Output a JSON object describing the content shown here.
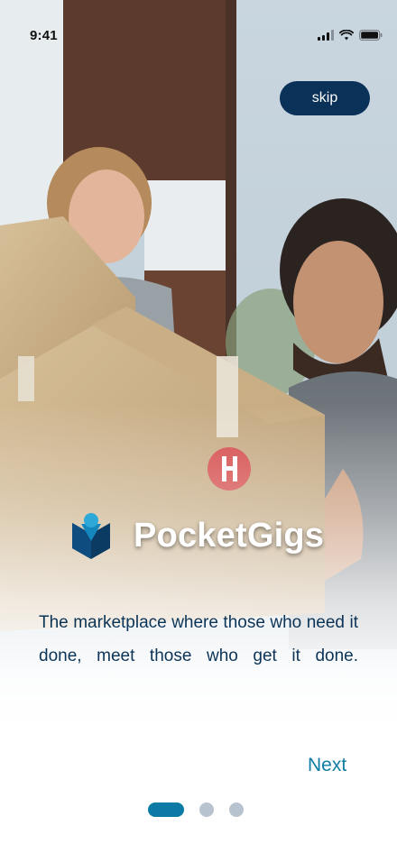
{
  "status_bar": {
    "time": "9:41",
    "icons": [
      "signal-icon",
      "wifi-icon",
      "battery-icon"
    ]
  },
  "hero": {
    "image": "photo-two-people-carrying-moving-boxes"
  },
  "skip_label": "skip",
  "brand": {
    "name": "PocketGigs",
    "logo_icon": "pocketgigs-logo-icon"
  },
  "tagline": "The marketplace where those who need it done, meet those who get it done.",
  "next_label": "Next",
  "pager": {
    "total": 3,
    "active_index": 0
  },
  "colors": {
    "navy": "#0a3157",
    "accent": "#0b7ba6",
    "inactive_dot": "#b7c3cf",
    "tagline_text": "#0c3457"
  }
}
